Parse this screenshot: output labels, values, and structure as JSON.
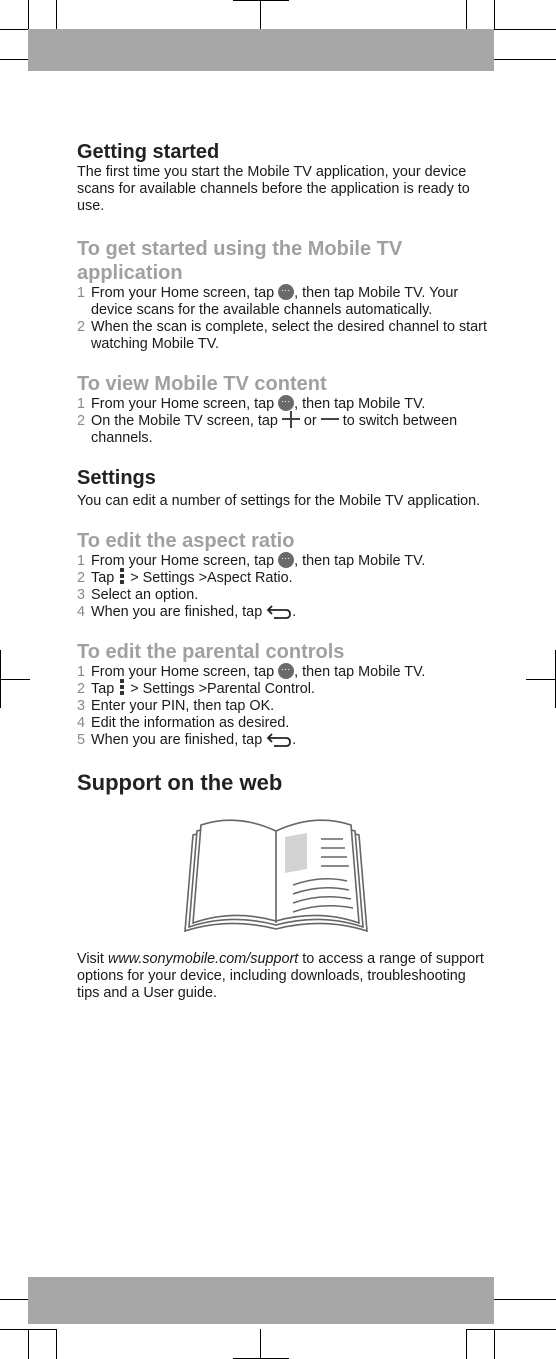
{
  "sections": {
    "getting_started": {
      "title": "Getting started",
      "body": "The first time you start the Mobile TV application, your device scans for available channels before the application is ready to use."
    },
    "get_started_task": {
      "title": "To get started using the Mobile TV application",
      "steps": [
        {
          "num": "1",
          "pre": "From your Home screen, tap ",
          "icon": "apps-icon",
          "post": ", then tap Mobile TV. Your device scans for the available channels automatically."
        },
        {
          "num": "2",
          "text": "When the scan is complete, select the desired channel to start watching Mobile TV."
        }
      ]
    },
    "view_content_task": {
      "title": "To view Mobile TV content",
      "steps": [
        {
          "num": "1",
          "pre": "From your Home screen, tap ",
          "icon": "apps-icon",
          "post": ", then tap Mobile TV."
        },
        {
          "num": "2",
          "pre": "On the Mobile TV screen, tap ",
          "mid": " or ",
          "post": " to switch between channels."
        }
      ]
    },
    "settings": {
      "title": "Settings",
      "body": "You can edit a number of settings for the Mobile TV application."
    },
    "aspect_task": {
      "title": "To edit the aspect ratio",
      "steps": [
        {
          "num": "1",
          "pre": "From your Home screen, tap ",
          "icon": "apps-icon",
          "post": ", then tap Mobile TV."
        },
        {
          "num": "2",
          "pre": "Tap ",
          "icon": "menu-icon",
          "post": " > Settings >Aspect Ratio."
        },
        {
          "num": "3",
          "text": "Select an option."
        },
        {
          "num": "4",
          "pre": "When you are finished, tap ",
          "icon": "back-icon",
          "post": "."
        }
      ]
    },
    "parental_task": {
      "title": "To edit the parental controls",
      "steps": [
        {
          "num": "1",
          "pre": "From your Home screen, tap ",
          "icon": "apps-icon",
          "post": ", then tap Mobile TV."
        },
        {
          "num": "2",
          "pre": "Tap ",
          "icon": "menu-icon",
          "post": " > Settings >Parental Control."
        },
        {
          "num": "3",
          "text": "Enter your PIN, then tap OK."
        },
        {
          "num": "4",
          "text": "Edit the information as desired."
        },
        {
          "num": "5",
          "pre": "When you are finished, tap ",
          "icon": "back-icon",
          "post": "."
        }
      ]
    },
    "support": {
      "title": "Support on the web",
      "illustration": "open-book-icon",
      "visit": "Visit ",
      "link": "www.sonymobile.com/support",
      "body": " to access a range of support options for your device, including downloads, troubleshooting tips and a User guide."
    }
  },
  "colors": {
    "heading_dark": "#222222",
    "heading_grey": "#a0a0a0",
    "bar_grey": "#a7a7a8"
  }
}
